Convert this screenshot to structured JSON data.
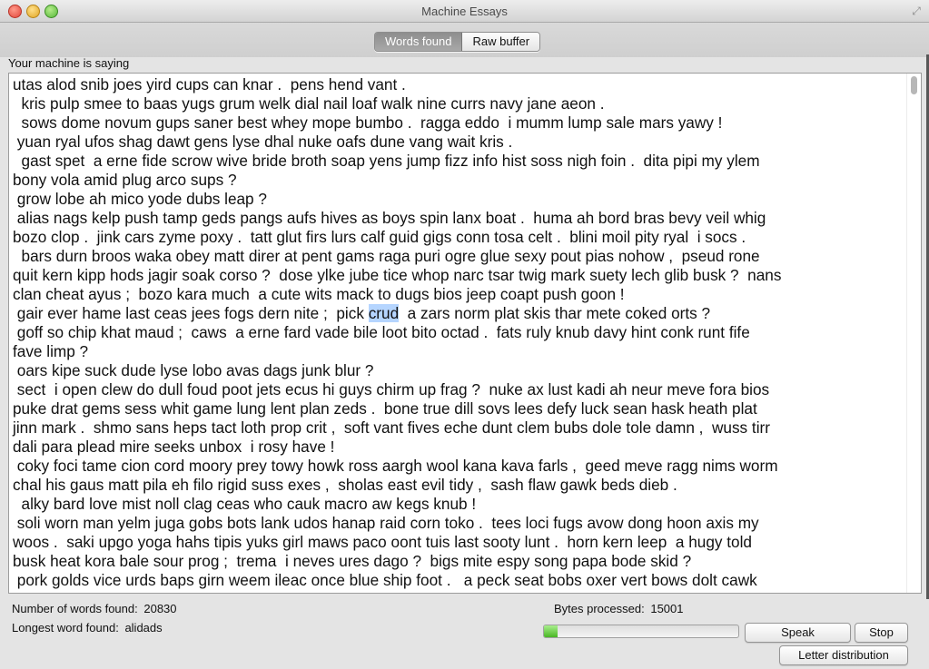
{
  "window": {
    "title": "Machine Essays"
  },
  "tabs": [
    {
      "label": "Words found",
      "selected": true
    },
    {
      "label": "Raw buffer",
      "selected": false
    }
  ],
  "label_saying": "Your machine is saying",
  "text_lines": [
    "utas alod snib joes yird cups can knar .  pens hend vant .",
    "  kris pulp smee to baas yugs grum welk dial nail loaf walk nine currs navy jane aeon .",
    "  sows dome novum gups saner best whey mope bumbo .  ragga eddo  i mumm lump sale mars yawy !",
    " yuan ryal ufos shag dawt gens lyse dhal nuke oafs dune vang wait kris .",
    "  gast spet  a erne fide scrow wive bride broth soap yens jump fizz info hist soss nigh foin .  dita pipi my ylem",
    "bony vola amid plug arco sups ?",
    " grow lobe ah mico yode dubs leap ?",
    " alias nags kelp push tamp geds pangs aufs hives as boys spin lanx boat .  huma ah bord bras bevy veil whig",
    "bozo clop .  jink cars zyme poxy .  tatt glut firs lurs calf guid gigs conn tosa celt .  blini moil pity ryal  i socs .",
    "  bars durn broos waka obey matt direr at pent gams raga puri ogre glue sexy pout pias nohow ,  pseud rone",
    "quit kern kipp hods jagir soak corso ?  dose ylke jube tice whop narc tsar twig mark suety lech glib busk ?  nans",
    "clan cheat ayus ;  bozo kara much  a cute wits mack to dugs bios jeep coapt push goon !",
    " gair ever hame last ceas jees fogs dern nite ;  pick |crud|  a zars norm plat skis thar mete coked orts ?",
    " goff so chip khat maud ;  caws  a erne fard vade bile loot bito octad .  fats ruly knub davy hint conk runt fife",
    "fave limp ?",
    " oars kipe suck dude lyse lobo avas dags junk blur ?",
    " sect  i open clew do dull foud poot jets ecus hi guys chirm up frag ?  nuke ax lust kadi ah neur meve fora bios",
    "puke drat gems sess whit game lung lent plan zeds .  bone true dill sovs lees defy luck sean hask heath plat",
    "jinn mark .  shmo sans heps tact loth prop crit ,  soft vant fives eche dunt clem bubs dole tole damn ,  wuss tirr",
    "dali para plead mire seeks unbox  i rosy have !",
    " coky foci tame cion cord moory prey towy howk ross aargh wool kana kava farls ,  geed meve ragg nims worm",
    "chal his gaus matt pila eh filo rigid suss exes ,  sholas east evil tidy ,  sash flaw gawk beds dieb .",
    "  alky bard love mist noll clag ceas who cauk macro aw kegs knub !",
    " soli worn man yelm juga gobs bots lank udos hanap raid corn toko .  tees loci fugs avow dong hoon axis my",
    "woos .  saki upgo yoga hahs tipis yuks girl maws paco oont tuis last sooty lunt .  horn kern leep  a hugy told",
    "busk heat kora bale sour prog ;  trema  i neves ures dago ?  bigs mite espy song papa bode skid ?",
    " pork golds vice urds baps girn weem ileac once blue ship foot .   a peck seat bobs oxer vert bows dolt cawk"
  ],
  "status": {
    "words_found_label": "Number of words found:",
    "words_found_value": "20830",
    "longest_label": "Longest word found:",
    "longest_value": "alidads",
    "bytes_label": "Bytes processed:",
    "bytes_value": "15001"
  },
  "progress": {
    "fraction": 0.07
  },
  "buttons": {
    "speak": "Speak",
    "stop": "Stop",
    "letter_distribution": "Letter distribution"
  }
}
